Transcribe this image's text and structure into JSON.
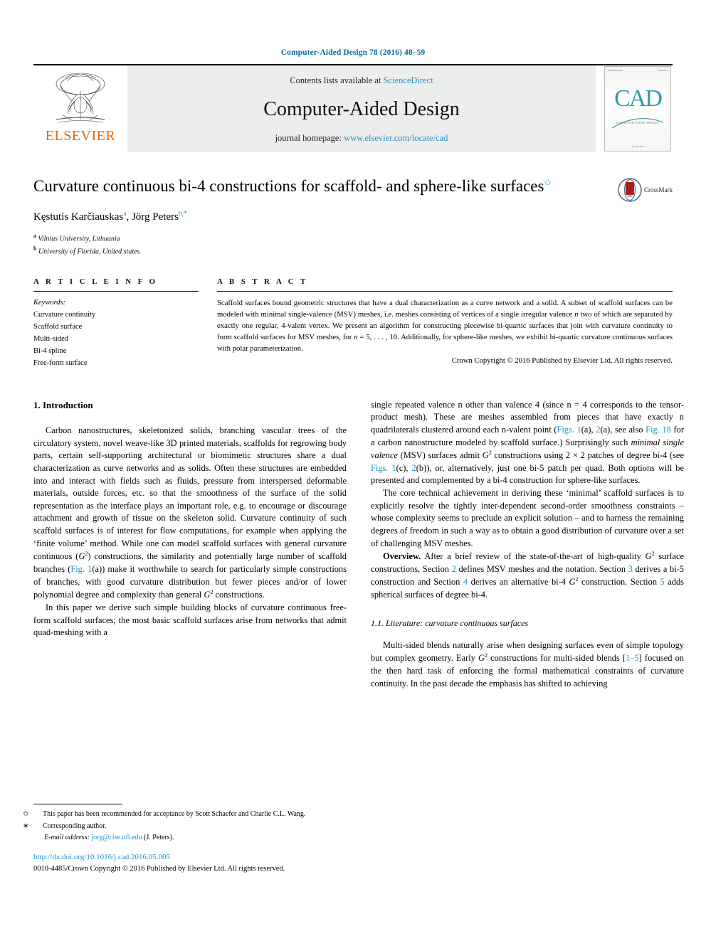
{
  "running_head": "Computer-Aided Design 78 (2016) 48–59",
  "masthead": {
    "publisher_name": "ELSEVIER",
    "contents_prefix": "Contents lists available at ",
    "contents_link": "ScienceDirect",
    "journal_title": "Computer-Aided Design",
    "homepage_prefix": "journal homepage: ",
    "homepage_link": "www.elsevier.com/locate/cad",
    "cover": {
      "letters": "CAD",
      "subtitle": "COMPUTER-AIDED DESIGN",
      "top_left": "ISSN 0010-4485",
      "top_right": "Volume 78",
      "footer": "ELSEVIER"
    }
  },
  "article": {
    "title": "Curvature continuous bi-4 constructions for scaffold- and sphere-like surfaces",
    "title_footnote_marker": "✩",
    "authors": "Kęstutis Karčiauskas",
    "author_a_marker": "a",
    "author_two": ", Jörg Peters",
    "author_b_marker": "b,",
    "author_b_star": "*",
    "affiliations": [
      {
        "marker": "a",
        "text": "Vilnius University, Lithuania"
      },
      {
        "marker": "b",
        "text": "University of Florida, United states"
      }
    ],
    "crossmark_label": "CrossMark"
  },
  "article_info": {
    "heading": "A R T I C L E   I N F O",
    "keywords_heading": "Keywords:",
    "keywords": [
      "Curvature continuity",
      "Scaffold surface",
      "Multi-sided",
      "Bi-4 spline",
      "Free-form surface"
    ]
  },
  "abstract": {
    "heading": "A B S T R A C T",
    "text_part1": "Scaffold surfaces bound geometric structures that have a dual characterization as a curve network and a solid. A subset of scaffold surfaces can be modeled with minimal single-valence (MSV) meshes, i.e. meshes consisting of vertices of a single irregular valence ",
    "n_italic_1": "n",
    "text_part2": " two of which are separated by exactly one regular, 4-valent vertex. We present an algorithm for constructing piecewise bi-quartic surfaces that join with curvature continuity to form scaffold surfaces for MSV meshes, for ",
    "n_italic_2": "n",
    "text_part3": " = 5, . . . , 10. Additionally, for sphere-like meshes, we exhibit bi-quartic curvature continuous surfaces with polar parameterization.",
    "copyright": "Crown Copyright © 2016 Published by Elsevier Ltd. All rights reserved."
  },
  "left_column": {
    "section_number_title": "1.  Introduction",
    "p1_a": "Carbon nanostructures, skeletonized solids, branching vascular trees of the circulatory system, novel weave-like 3D printed materials, scaffolds for regrowing body parts, certain self-supporting architectural or biomimetic structures share a dual characterization as curve networks and as solids. Often these structures are embedded into and interact with fields such as fluids, pressure from interspersed deformable materials, outside forces, etc. so that the smoothness of the surface of the solid representation as the interface plays an important role, e.g. to encourage or discourage attachment and growth of tissue on the skeleton solid. Curvature continuity of such scaffold surfaces is of interest for flow computations, for example when applying the ‘finite volume’ method. While one can model scaffold surfaces with general curvature continuous (",
    "p1_g2": "G",
    "p1_b": ") constructions, the similarity and potentially large number of scaffold branches (",
    "p1_link1": "Fig. 1",
    "p1_c": "(a)) make it worthwhile to search for particularly simple constructions of branches, with good curvature distribution but fewer pieces and/or of lower polynomial degree and complexity than general ",
    "p1_d": " constructions.",
    "p2": "In this paper we derive such simple building blocks of curvature continuous free-form scaffold surfaces; the most basic scaffold surfaces arise from networks that admit quad-meshing with a"
  },
  "right_column": {
    "p1_a": "single repeated valence ",
    "p1_n1": "n",
    "p1_b": " other than valence 4 (since ",
    "p1_n2": "n",
    "p1_c": " = 4 corresponds to the tensor-product mesh). These are meshes assembled from pieces that have exactly n quadrilaterals clustered around each n-valent point (",
    "p1_link1": "Figs. 1",
    "p1_d": "(a), ",
    "p1_link2": "2",
    "p1_e": "(a), see also ",
    "p1_link3": "Fig. 18",
    "p1_f": " for a carbon nanostructure modeled by scaffold surface.) Surprisingly such ",
    "p1_it1": "minimal single valence",
    "p1_g": " (MSV) surfaces admit ",
    "p1_h": " constructions using 2 × 2 patches of degree bi-4 (see ",
    "p1_link4": "Figs. 1",
    "p1_i": "(c), ",
    "p1_link5": "2",
    "p1_j": "(b)), or, alternatively, just one bi-5 patch per quad. Both options will be presented and complemented by a bi-4 construction for sphere-like surfaces.",
    "p2_a": "The core technical achievement in deriving these ‘minimal’ scaffold surfaces is to explicitly resolve the tightly inter-dependent second-order smoothness constraints – whose complexity seems to preclude an explicit solution – and to harness the remaining degrees of freedom in such a way as to obtain a good distribution of curvature over a set of challenging MSV meshes.",
    "p3_bold": "Overview.",
    "p3_a": " After a brief review of the state-of-the-art of high-quality ",
    "p3_b": " surface constructions, Section ",
    "p3_link1": "2",
    "p3_c": " defines MSV meshes and the notation. Section ",
    "p3_link2": "3",
    "p3_d": " derives a bi-5 construction and Section ",
    "p3_link3": "4",
    "p3_e": " derives an alternative bi-4 ",
    "p3_f": " construction. Section ",
    "p3_link4": "5",
    "p3_g": " adds spherical surfaces of degree bi-4.",
    "subsection_title": "1.1.  Literature: curvature continuous surfaces",
    "p4_a": "Multi-sided blends naturally arise when designing surfaces even of simple topology but complex geometry. Early ",
    "p4_b": " constructions for multi-sided blends [",
    "p4_link1": "1–5",
    "p4_c": "] focused on the then hard task of enforcing the formal mathematical constraints of curvature continuity. In the past decade the emphasis has shifted to achieving"
  },
  "footnotes": {
    "fn1_marker": "✩",
    "fn1_text": "This paper has been recommended for acceptance by Scott Schaefer and Charlie C.L. Wang.",
    "fn2_marker": "∗",
    "fn2_text": "Corresponding author.",
    "email_label": "E-mail address:",
    "email_link": "jorg@cise.ufl.edu",
    "email_suffix": " (J. Peters).",
    "doi": "http://dx.doi.org/10.1016/j.cad.2016.05.005",
    "issn_copyright": "0010-4485/Crown Copyright © 2016 Published by Elsevier Ltd. All rights reserved."
  },
  "colors": {
    "link_blue": "#1f93c6",
    "header_blue": "#0b6a9b",
    "elsevier_orange": "#ec6608",
    "cad_teal": "#2e9ca3",
    "masthead_grey": "#eceded"
  }
}
